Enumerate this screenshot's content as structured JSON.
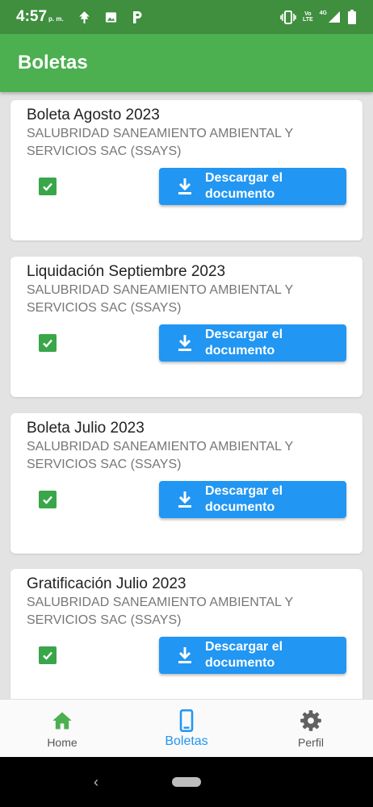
{
  "status_bar": {
    "time": "4:57",
    "ampm": "p. m.",
    "network_volte": "Vo",
    "network_lte": "LTE",
    "network_4g": "4G",
    "icons": [
      "app-notification-icon",
      "image-icon",
      "parking-icon",
      "vibrate-icon",
      "signal-icon",
      "battery-icon"
    ]
  },
  "app_bar": {
    "title": "Boletas"
  },
  "cards": [
    {
      "title": "Boleta Agosto 2023",
      "company": "SALUBRIDAD SANEAMIENTO AMBIENTAL Y SERVICIOS SAC (SSAYS)",
      "checked": true,
      "button_label": "Descargar el documento"
    },
    {
      "title": "Liquidación Septiembre 2023",
      "company": "SALUBRIDAD SANEAMIENTO AMBIENTAL Y SERVICIOS SAC (SSAYS)",
      "checked": true,
      "button_label": "Descargar el documento"
    },
    {
      "title": "Boleta Julio 2023",
      "company": "SALUBRIDAD SANEAMIENTO AMBIENTAL Y SERVICIOS SAC (SSAYS)",
      "checked": true,
      "button_label": "Descargar el documento"
    },
    {
      "title": "Gratificación Julio 2023",
      "company": "SALUBRIDAD SANEAMIENTO AMBIENTAL Y SERVICIOS SAC (SSAYS)",
      "checked": true,
      "button_label": "Descargar el documento"
    }
  ],
  "bottom_nav": {
    "items": [
      {
        "label": "Home",
        "icon": "home-icon",
        "active": false
      },
      {
        "label": "Boletas",
        "icon": "phone-icon",
        "active": true
      },
      {
        "label": "Perfil",
        "icon": "gear-icon",
        "active": false
      }
    ]
  },
  "system_nav": {
    "back_glyph": "‹"
  },
  "colors": {
    "status_bar": "#3f8f3e",
    "app_bar": "#4caf50",
    "button": "#2196f3",
    "checkbox": "#3aa64a",
    "nav_active": "#2196f3",
    "home_icon": "#4caf50"
  }
}
